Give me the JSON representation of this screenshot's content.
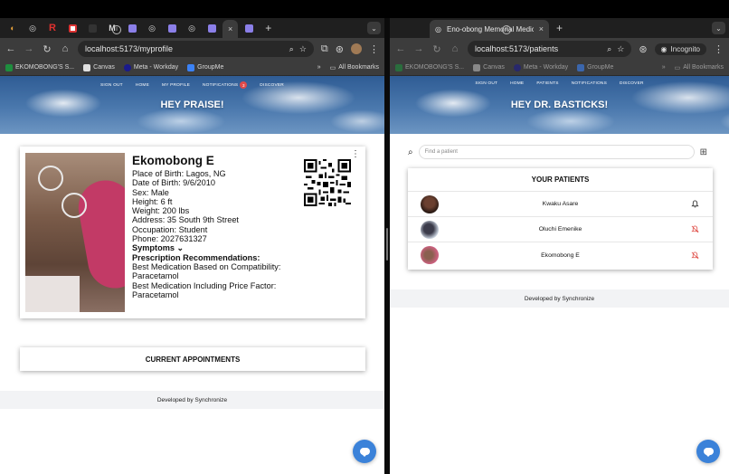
{
  "left_window": {
    "tabstrip": {
      "icons": [
        "chrome-web-icon",
        "r-app-icon",
        "red-square-icon",
        "m-app-icon",
        "purple-app-icon",
        "chrome-web-icon",
        "purple-app-icon"
      ],
      "new_tab": "+",
      "active_tab_close": "×"
    },
    "address": "localhost:5173/myprofile",
    "bookmarks": [
      {
        "label": "EKOMOBONG'S S...",
        "color": "#1e8e3e"
      },
      {
        "label": "Canvas",
        "color": "#e0e0e0"
      },
      {
        "label": "Meta - Workday",
        "color": "#1a1a8c"
      },
      {
        "label": "GroupMe",
        "color": "#3b82f6"
      }
    ],
    "bookmarks_more": "»",
    "all_bookmarks": "All Bookmarks",
    "nav": [
      "SIGN OUT",
      "HOME",
      "MY PROFILE",
      "NOTIFICATIONS",
      "DISCOVER"
    ],
    "notif_count": "3",
    "hero_title": "HEY PRAISE!",
    "profile": {
      "name": "Ekomobong E",
      "place_of_birth": "Place of Birth: Lagos, NG",
      "dob": "Date of Birth: 9/6/2010",
      "sex": "Sex: Male",
      "height": "Height: 6 ft",
      "weight": "Weight: 200 lbs",
      "address": "Address: 35 South 9th Street",
      "occupation": "Occupation: Student",
      "phone": "Phone: 2027631327",
      "symptoms": "Symptoms",
      "prescription_header": "Prescription Recommendations:",
      "compat_label": "Best Medication Based on Compatibility:",
      "compat_value": "Paracetamol",
      "price_label": "Best Medication Including Price Factor:",
      "price_value": "Paracetamol"
    },
    "appointments_title": "CURRENT APPOINTMENTS",
    "footer": "Developed by Synchronize"
  },
  "right_window": {
    "tab_title": "Eno-obong Memorial Medical",
    "tab_close": "×",
    "new_tab": "+",
    "address": "localhost:5173/patients",
    "incognito": "Incognito",
    "bookmarks": [
      {
        "label": "EKOMOBONG'S S...",
        "color": "#1e8e3e"
      },
      {
        "label": "Canvas",
        "color": "#e0e0e0"
      },
      {
        "label": "Meta - Workday",
        "color": "#1a1a8c"
      },
      {
        "label": "GroupMe",
        "color": "#3b82f6"
      }
    ],
    "bookmarks_more": "»",
    "all_bookmarks": "All Bookmarks",
    "nav": [
      "SIGN OUT",
      "HOME",
      "PATIENTS",
      "NOTIFICATIONS",
      "DISCOVER"
    ],
    "hero_title": "HEY DR. BASTICKS!",
    "search_placeholder": "Find a patient",
    "patients_title": "YOUR PATIENTS",
    "patients": [
      {
        "name": "Kwaku Asare",
        "avatar_color": "#5a3a2a",
        "bell": "bell-icon",
        "bell_color": "#222222"
      },
      {
        "name": "Oluchi Emenike",
        "avatar_color": "#4a5a78",
        "bell": "bell-off-icon",
        "bell_color": "#e0504a"
      },
      {
        "name": "Ekomobong E",
        "avatar_color": "#c9607d",
        "bell": "bell-off-icon",
        "bell_color": "#e0504a"
      }
    ],
    "footer": "Developed by Synchronize"
  },
  "colors": {
    "chrome_dark": "#1f1f1f",
    "toolbar": "#3c3c3c",
    "accent_blue": "#3b82d9",
    "notif_red": "#e04a4a"
  }
}
